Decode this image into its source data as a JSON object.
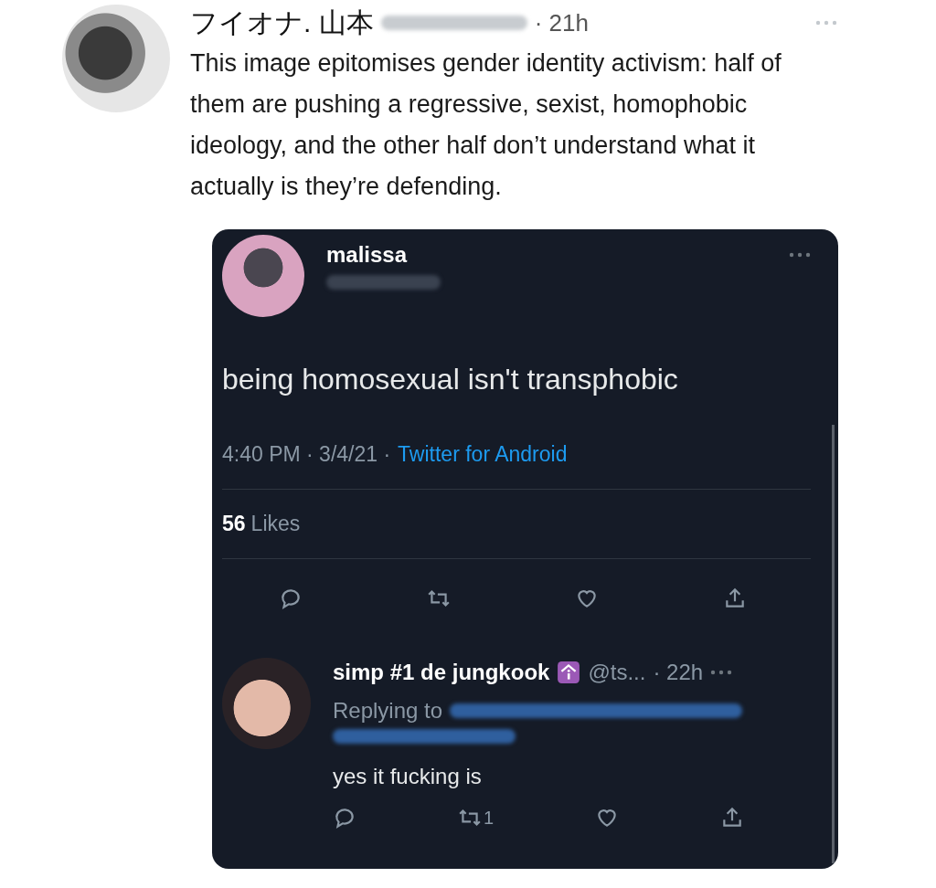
{
  "tweet": {
    "author": "フイオナ. 山本",
    "time": "· 21h",
    "text": "This image epitomises gender identity activism: half of them are pushing a regressive, sexist, homophobic ideology, and the other half don’t understand what it actually is they’re defending."
  },
  "screenshot": {
    "main_tweet": {
      "author": "malissa",
      "text": "being homosexual isn't transphobic",
      "timestamp": "4:40 PM · 3/4/21 ·",
      "source": "Twitter for Android",
      "likes_count": "56",
      "likes_label": "Likes"
    },
    "reply": {
      "author": "simp #1 de jungkook",
      "handle": "@ts...",
      "time": "· 22h",
      "replying_label": "Replying to",
      "text": "yes it fucking is",
      "retweet_count": "1"
    }
  }
}
